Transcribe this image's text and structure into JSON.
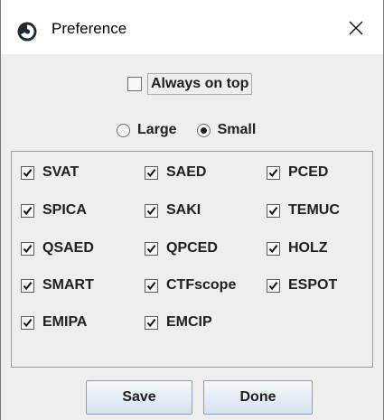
{
  "window": {
    "title": "Preference",
    "icons": {
      "app": "app-logo-icon",
      "close": "close-icon"
    }
  },
  "always_on_top": {
    "label": "Always on top",
    "checked": false
  },
  "size_options": [
    {
      "label": "Large",
      "selected": false
    },
    {
      "label": "Small",
      "selected": true
    }
  ],
  "options": [
    {
      "label": "SVAT",
      "checked": true
    },
    {
      "label": "SAED",
      "checked": true
    },
    {
      "label": "PCED",
      "checked": true
    },
    {
      "label": "SPICA",
      "checked": true
    },
    {
      "label": "SAKI",
      "checked": true
    },
    {
      "label": "TEMUC",
      "checked": true
    },
    {
      "label": "QSAED",
      "checked": true
    },
    {
      "label": "QPCED",
      "checked": true
    },
    {
      "label": "HOLZ",
      "checked": true
    },
    {
      "label": "SMART",
      "checked": true
    },
    {
      "label": "CTFscope",
      "checked": true
    },
    {
      "label": "ESPOT",
      "checked": true
    },
    {
      "label": "EMIPA",
      "checked": true
    },
    {
      "label": "EMCIP",
      "checked": true
    }
  ],
  "buttons": {
    "save": "Save",
    "done": "Done"
  },
  "colors": {
    "dialog_bg": "#eeeeee",
    "button_border": "#8e9fb5"
  }
}
